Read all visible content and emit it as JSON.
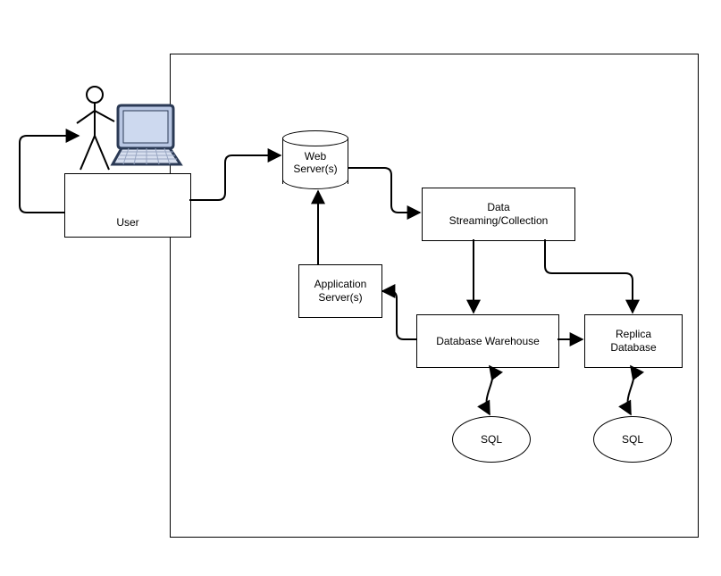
{
  "nodes": {
    "user": "User",
    "web_server": "Web\nServer(s)",
    "data_streaming": "Data\nStreaming/Collection",
    "application_server": "Application\nServer(s)",
    "database_warehouse": "Database Warehouse",
    "replica_database": "Replica\nDatabase",
    "sql_left": "SQL",
    "sql_right": "SQL"
  },
  "edges": [
    {
      "from": "user",
      "to": "web_server",
      "style": "elbow",
      "bidir": false
    },
    {
      "from": "web_server",
      "to": "data_streaming",
      "style": "elbow",
      "bidir": false
    },
    {
      "from": "data_streaming",
      "to": "database_warehouse",
      "style": "elbow",
      "bidir": false
    },
    {
      "from": "data_streaming",
      "to": "replica_database",
      "style": "elbow",
      "bidir": false
    },
    {
      "from": "database_warehouse",
      "to": "replica_database",
      "style": "straight",
      "bidir": false
    },
    {
      "from": "application_server",
      "to": "web_server",
      "style": "elbow",
      "bidir": false
    },
    {
      "from": "database_warehouse",
      "to": "application_server",
      "style": "elbow",
      "bidir": false
    },
    {
      "from": "database_warehouse",
      "to": "sql_left",
      "style": "curvy",
      "bidir": true
    },
    {
      "from": "replica_database",
      "to": "sql_right",
      "style": "curvy",
      "bidir": true
    },
    {
      "from": "user",
      "to": "user",
      "style": "loop",
      "bidir": false
    }
  ],
  "icons": {
    "user_figure": "stick-figure-with-laptop"
  }
}
